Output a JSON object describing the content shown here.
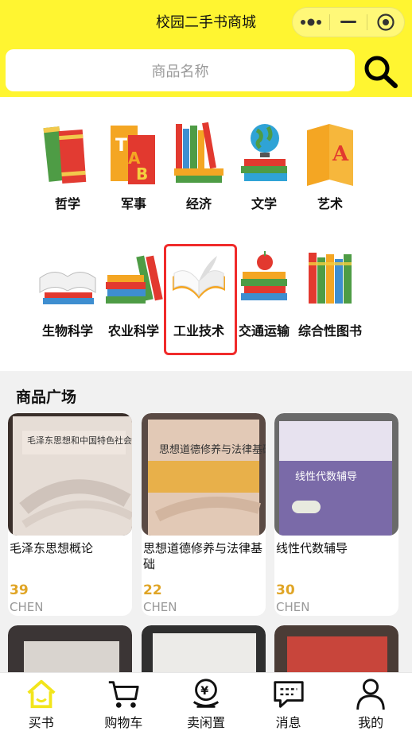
{
  "header": {
    "title": "校园二手书商城"
  },
  "search": {
    "placeholder": "商品名称"
  },
  "categories": [
    {
      "label": "哲学",
      "icon": "books-icon"
    },
    {
      "label": "军事",
      "icon": "abc-books-icon"
    },
    {
      "label": "经济",
      "icon": "book-stack-icon"
    },
    {
      "label": "文学",
      "icon": "globe-books-icon"
    },
    {
      "label": "艺术",
      "icon": "letter-a-book-icon"
    },
    {
      "label": "生物科学",
      "icon": "open-book-icon"
    },
    {
      "label": "农业科学",
      "icon": "shelf-books-icon"
    },
    {
      "label": "工业技术",
      "icon": "open-book-icon"
    },
    {
      "label": "交通运输",
      "icon": "apple-books-icon"
    },
    {
      "label": "综合性图书",
      "icon": "book-row-icon"
    }
  ],
  "section": {
    "title": "商品广场"
  },
  "products": [
    {
      "name": "毛泽东思想概论",
      "price": "39",
      "seller": "CHEN",
      "cover_text": "毛泽东思想和中国特色社会主义理论体系概论"
    },
    {
      "name": "思想道德修养与法律基础",
      "price": "22",
      "seller": "CHEN",
      "cover_text": "思想道德修养与法律基础"
    },
    {
      "name": "线性代数辅导",
      "price": "30",
      "seller": "CHEN",
      "cover_text": "线性代数辅导"
    }
  ],
  "tabs": [
    {
      "label": "买书",
      "icon": "home-icon"
    },
    {
      "label": "购物车",
      "icon": "cart-icon"
    },
    {
      "label": "卖闲置",
      "icon": "yen-icon"
    },
    {
      "label": "消息",
      "icon": "message-icon"
    },
    {
      "label": "我的",
      "icon": "user-icon"
    }
  ],
  "colors": {
    "accent": "#fff531",
    "price": "#e0a526",
    "selected": "#f02b2b"
  }
}
